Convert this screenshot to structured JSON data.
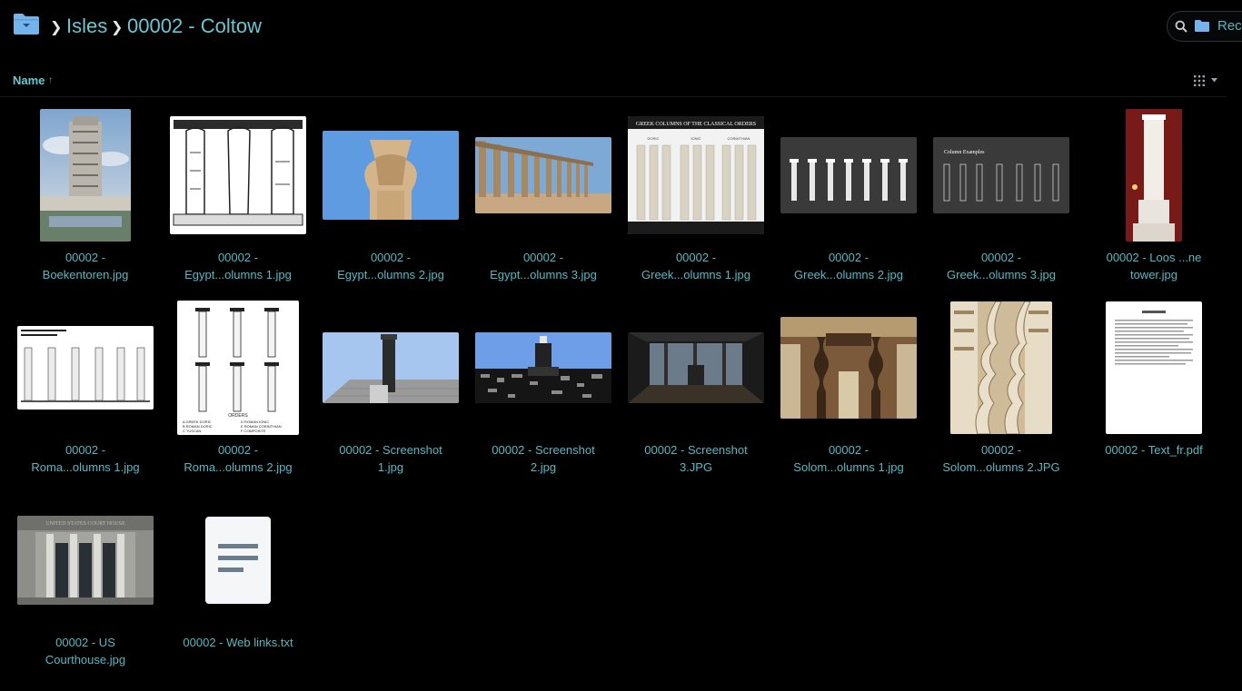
{
  "breadcrumb": {
    "items": [
      "Isles",
      "00002 - Coltow"
    ]
  },
  "search": {
    "scope": "Rech"
  },
  "sort": {
    "label": "Name",
    "direction": "ascending"
  },
  "files": [
    {
      "name": "00002 - Boekentoren.jpg",
      "line1": "00002 -",
      "line2": "Boekentoren.jpg"
    },
    {
      "name": "00002 - Egypt...olumns 1.jpg",
      "line1": "00002 -",
      "line2": "Egypt...olumns 1.jpg"
    },
    {
      "name": "00002 - Egypt...olumns 2.jpg",
      "line1": "00002 -",
      "line2": "Egypt...olumns 2.jpg"
    },
    {
      "name": "00002 - Egypt...olumns 3.jpg",
      "line1": "00002 -",
      "line2": "Egypt...olumns 3.jpg"
    },
    {
      "name": "00002 - Greek...olumns 1.jpg",
      "line1": "00002 -",
      "line2": "Greek...olumns 1.jpg"
    },
    {
      "name": "00002 - Greek...olumns 2.jpg",
      "line1": "00002 -",
      "line2": "Greek...olumns 2.jpg"
    },
    {
      "name": "00002 - Greek...olumns 3.jpg",
      "line1": "00002 -",
      "line2": "Greek...olumns 3.jpg"
    },
    {
      "name": "00002 - Loos ...ne tower.jpg",
      "line1": "00002 - Loos ...ne",
      "line2": "tower.jpg"
    },
    {
      "name": "00002 - Roma...olumns 1.jpg",
      "line1": "00002 -",
      "line2": "Roma...olumns 1.jpg"
    },
    {
      "name": "00002 - Roma...olumns 2.jpg",
      "line1": "00002 -",
      "line2": "Roma...olumns 2.jpg"
    },
    {
      "name": "00002 - Screenshot 1.jpg",
      "line1": "00002 - Screenshot",
      "line2": "1.jpg"
    },
    {
      "name": "00002 - Screenshot 2.jpg",
      "line1": "00002 - Screenshot",
      "line2": "2.jpg"
    },
    {
      "name": "00002 - Screenshot 3.JPG",
      "line1": "00002 - Screenshot",
      "line2": "3.JPG"
    },
    {
      "name": "00002 - Solom...olumns 1.jpg",
      "line1": "00002 -",
      "line2": "Solom...olumns 1.jpg"
    },
    {
      "name": "00002 - Solom...olumns 2.JPG",
      "line1": "00002 -",
      "line2": "Solom...olumns 2.JPG"
    },
    {
      "name": "00002 - Text_fr.pdf",
      "line1": "00002 - Text_fr.pdf",
      "line2": ""
    },
    {
      "name": "00002 - US Courthouse.jpg",
      "line1": "00002 - US",
      "line2": "Courthouse.jpg"
    },
    {
      "name": "00002 - Web links.txt",
      "line1": "00002 - Web links.txt",
      "line2": ""
    }
  ],
  "thumb_text": {
    "greek_columns_1_title": "GREEK COLUMNS OF THE CLASSICAL ORDERS",
    "greek_columns_1_orders": [
      "DORIC",
      "IONIC",
      "CORINTHIAN"
    ],
    "greek_columns_3_title": "Column Examples",
    "roman_columns_2_heading": "ORDERS",
    "roman_columns_2_legend": [
      "A  GREEK DORIC",
      "B  ROMAN DORIC",
      "C  TUSCAN",
      "D  ROMAN IONIC",
      "E  ROMAN CORINTHIAN",
      "F  COMPOSITE"
    ],
    "courthouse_inscription": "UNITED STATES COURT HOUSE"
  },
  "colors": {
    "background": "#000000",
    "accent": "#58b8c2",
    "folder": "#74b4ea"
  }
}
